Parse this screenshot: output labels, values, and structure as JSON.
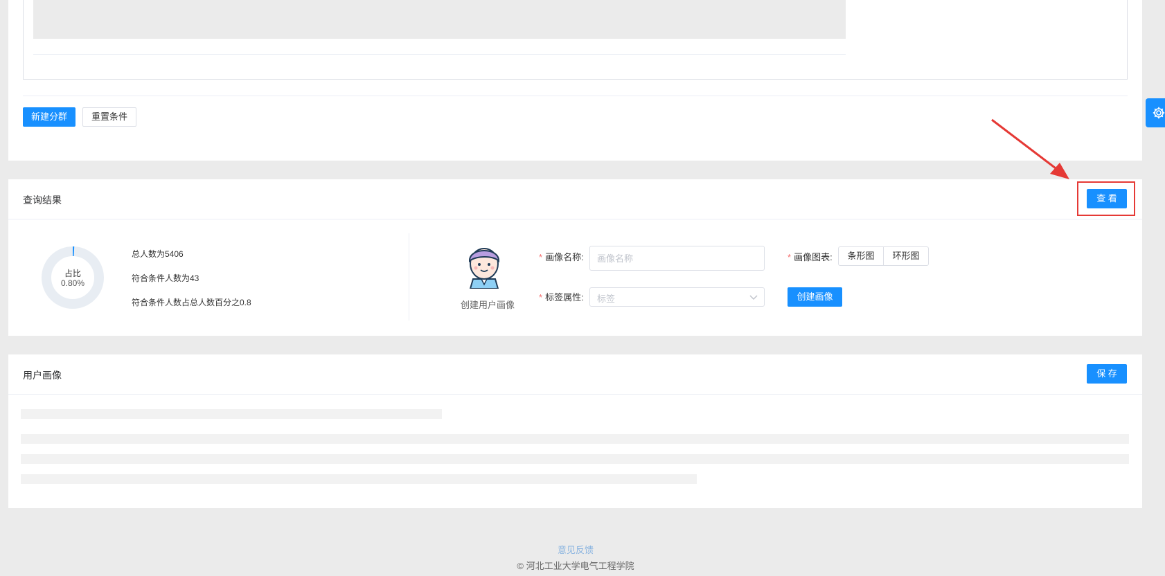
{
  "filter_actions": {
    "new_group": "新建分群",
    "reset": "重置条件"
  },
  "query_result": {
    "title": "查询结果",
    "view_button": "查 看",
    "donut": {
      "label": "占比",
      "percent_text": "0.80%",
      "fraction": 0.008
    },
    "stats": [
      "总人数为5406",
      "符合条件人数为43",
      "符合条件人数占总人数百分之0.8"
    ],
    "create_portrait_caption": "创建用户画像",
    "form": {
      "name_label": "画像名称:",
      "name_placeholder": "画像名称",
      "chart_label": "画像图表:",
      "chart_options": [
        "条形图",
        "环形图"
      ],
      "tag_label": "标签属性:",
      "tag_placeholder": "标签",
      "create_button": "创建画像"
    }
  },
  "user_portrait": {
    "title": "用户画像",
    "save_button": "保 存"
  },
  "footer": {
    "feedback": "意见反馈",
    "copyright": "© 河北工业大学电气工程学院"
  },
  "colors": {
    "primary": "#1890ff",
    "required_mark": "#f56c6c",
    "annotation": "#e53935"
  }
}
